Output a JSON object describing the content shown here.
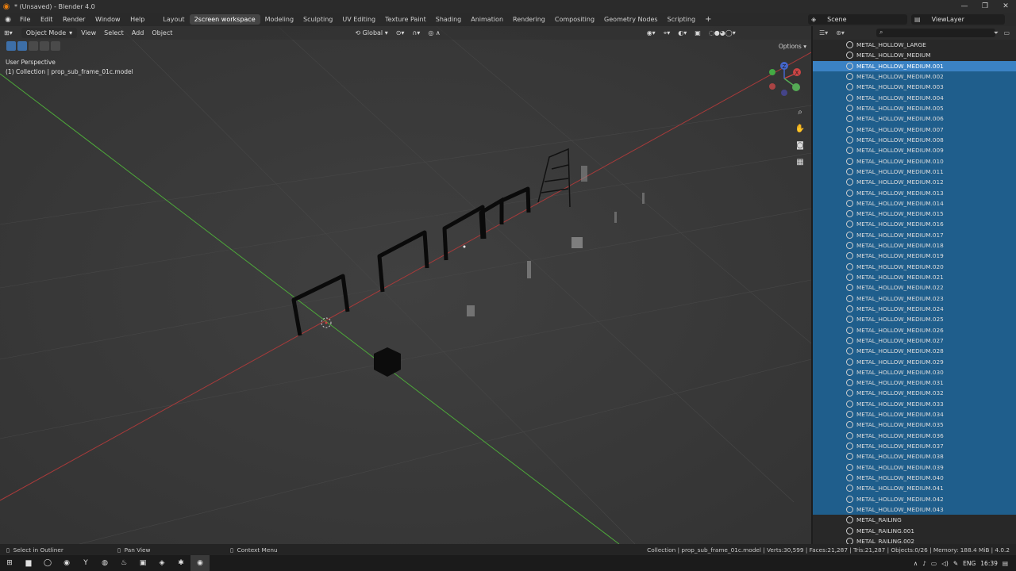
{
  "window": {
    "title": "* (Unsaved) - Blender 4.0",
    "controls": [
      "—",
      "❐",
      "✕"
    ]
  },
  "menu": [
    "File",
    "Edit",
    "Render",
    "Window",
    "Help"
  ],
  "workspaces": [
    "Layout",
    "2screen workspace",
    "Modeling",
    "Sculpting",
    "UV Editing",
    "Texture Paint",
    "Shading",
    "Animation",
    "Rendering",
    "Compositing",
    "Geometry Nodes",
    "Scripting"
  ],
  "active_workspace": "2screen workspace",
  "scene_name": "Scene",
  "view_layer": "ViewLayer",
  "viewport": {
    "mode": "Object Mode",
    "menu": [
      "View",
      "Select",
      "Add",
      "Object"
    ],
    "transform_orientation": "Global",
    "perspective": "User Perspective",
    "collection_info": "(1) Collection | prop_sub_frame_01c.model",
    "options_label": "Options"
  },
  "outliner": {
    "items": [
      "METAL_HOLLOW_LARGE",
      "METAL_HOLLOW_MEDIUM",
      "METAL_HOLLOW_MEDIUM.001",
      "METAL_HOLLOW_MEDIUM.002",
      "METAL_HOLLOW_MEDIUM.003",
      "METAL_HOLLOW_MEDIUM.004",
      "METAL_HOLLOW_MEDIUM.005",
      "METAL_HOLLOW_MEDIUM.006",
      "METAL_HOLLOW_MEDIUM.007",
      "METAL_HOLLOW_MEDIUM.008",
      "METAL_HOLLOW_MEDIUM.009",
      "METAL_HOLLOW_MEDIUM.010",
      "METAL_HOLLOW_MEDIUM.011",
      "METAL_HOLLOW_MEDIUM.012",
      "METAL_HOLLOW_MEDIUM.013",
      "METAL_HOLLOW_MEDIUM.014",
      "METAL_HOLLOW_MEDIUM.015",
      "METAL_HOLLOW_MEDIUM.016",
      "METAL_HOLLOW_MEDIUM.017",
      "METAL_HOLLOW_MEDIUM.018",
      "METAL_HOLLOW_MEDIUM.019",
      "METAL_HOLLOW_MEDIUM.020",
      "METAL_HOLLOW_MEDIUM.021",
      "METAL_HOLLOW_MEDIUM.022",
      "METAL_HOLLOW_MEDIUM.023",
      "METAL_HOLLOW_MEDIUM.024",
      "METAL_HOLLOW_MEDIUM.025",
      "METAL_HOLLOW_MEDIUM.026",
      "METAL_HOLLOW_MEDIUM.027",
      "METAL_HOLLOW_MEDIUM.028",
      "METAL_HOLLOW_MEDIUM.029",
      "METAL_HOLLOW_MEDIUM.030",
      "METAL_HOLLOW_MEDIUM.031",
      "METAL_HOLLOW_MEDIUM.032",
      "METAL_HOLLOW_MEDIUM.033",
      "METAL_HOLLOW_MEDIUM.034",
      "METAL_HOLLOW_MEDIUM.035",
      "METAL_HOLLOW_MEDIUM.036",
      "METAL_HOLLOW_MEDIUM.037",
      "METAL_HOLLOW_MEDIUM.038",
      "METAL_HOLLOW_MEDIUM.039",
      "METAL_HOLLOW_MEDIUM.040",
      "METAL_HOLLOW_MEDIUM.041",
      "METAL_HOLLOW_MEDIUM.042",
      "METAL_HOLLOW_MEDIUM.043",
      "METAL_RAILING",
      "METAL_RAILING.001",
      "METAL_RAILING.002"
    ],
    "active_index": 2,
    "selected_range": [
      2,
      44
    ]
  },
  "status": {
    "select_hint": "Select in Outliner",
    "pan_hint": "Pan View",
    "context_hint": "Context Menu",
    "stats": "Collection | prop_sub_frame_01c.model | Verts:30,599 | Faces:21,287 | Tris:21,287 | Objects:0/26 | Memory: 188.4 MiB | 4.0.2"
  },
  "taskbar": {
    "language": "ENG",
    "time": "16:39"
  },
  "colors": {
    "selection": "#1f5e8c",
    "active_selection": "#3b82c4",
    "x_axis": "#b23a3a",
    "y_axis": "#4da83a"
  }
}
